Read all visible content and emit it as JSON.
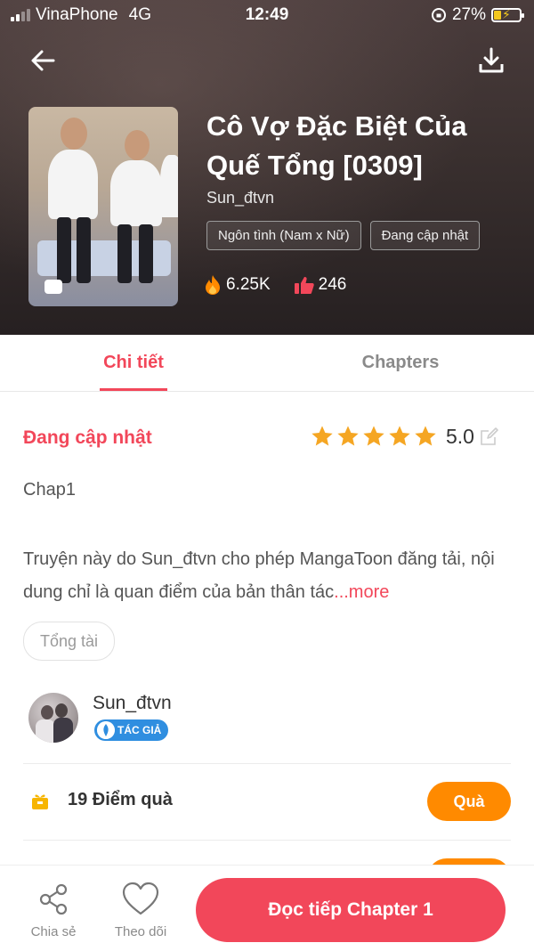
{
  "status_bar": {
    "carrier": "VinaPhone",
    "network": "4G",
    "time": "12:49",
    "battery": "27%"
  },
  "header": {
    "title": "Cô Vợ Đặc Biệt Của Quế Tổng [0309]",
    "author": "Sun_đtvn",
    "tags": [
      "Ngôn tình (Nam x Nữ)",
      "Đang cập nhật"
    ],
    "views": "6.25K",
    "likes": "246",
    "back_icon": "arrow-left-icon",
    "download_icon": "download-icon"
  },
  "tabs": [
    {
      "label": "Chi tiết",
      "active": true
    },
    {
      "label": "Chapters",
      "active": false
    }
  ],
  "details": {
    "status": "Đang cập nhật",
    "rating": "5.0",
    "stars": 5,
    "latest_chapter": "Chap1",
    "description": "Truyện này do Sun_đtvn cho phép MangaToon đăng tải, nội dung chỉ là quan điểm của bản thân tác",
    "more_label": "...more",
    "genre_tag": "Tổng tài"
  },
  "author_section": {
    "name": "Sun_đtvn",
    "badge": "TÁC GIẢ"
  },
  "gift": {
    "text": "19 Điểm quà",
    "button": "Quà"
  },
  "bottom_bar": {
    "share_label": "Chia sẻ",
    "follow_label": "Theo dõi",
    "read_label": "Đọc tiếp Chapter 1"
  },
  "colors": {
    "accent": "#f2475a",
    "orange": "#ff8a00",
    "star": "#f5a623",
    "badge": "#2f8ee0"
  }
}
